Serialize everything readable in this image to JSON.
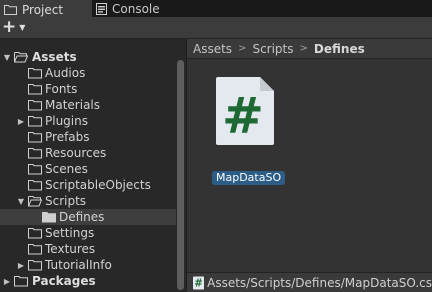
{
  "tabs": [
    {
      "label": "Project",
      "icon": "folder-icon"
    },
    {
      "label": "Console",
      "icon": "console-icon"
    }
  ],
  "toolbar": {
    "add_label": "+",
    "add_caret": "▼"
  },
  "tree": [
    {
      "label": "Assets",
      "expanded": true,
      "bold": true
    },
    {
      "label": "Audios"
    },
    {
      "label": "Fonts"
    },
    {
      "label": "Materials"
    },
    {
      "label": "Plugins",
      "collapsed": true
    },
    {
      "label": "Prefabs"
    },
    {
      "label": "Resources"
    },
    {
      "label": "Scenes"
    },
    {
      "label": "ScriptableObjects"
    },
    {
      "label": "Scripts",
      "expanded": true
    },
    {
      "label": "Defines",
      "selected": true
    },
    {
      "label": "Settings"
    },
    {
      "label": "Textures"
    },
    {
      "label": "TutorialInfo",
      "collapsed": true
    },
    {
      "label": "Packages",
      "collapsed": true,
      "bold": true
    }
  ],
  "breadcrumb": {
    "items": [
      "Assets",
      "Scripts",
      "Defines"
    ],
    "separator": ">"
  },
  "asset": {
    "name": "MapDataSO",
    "glyph": "#",
    "icon": "csharp-script-icon"
  },
  "status": {
    "path": "Assets/Scripts/Defines/MapDataSO.cs"
  },
  "colors": {
    "selection": "#2c5d87",
    "script_hash": "#1f6a34",
    "script_bg": "#e4e8ef"
  }
}
